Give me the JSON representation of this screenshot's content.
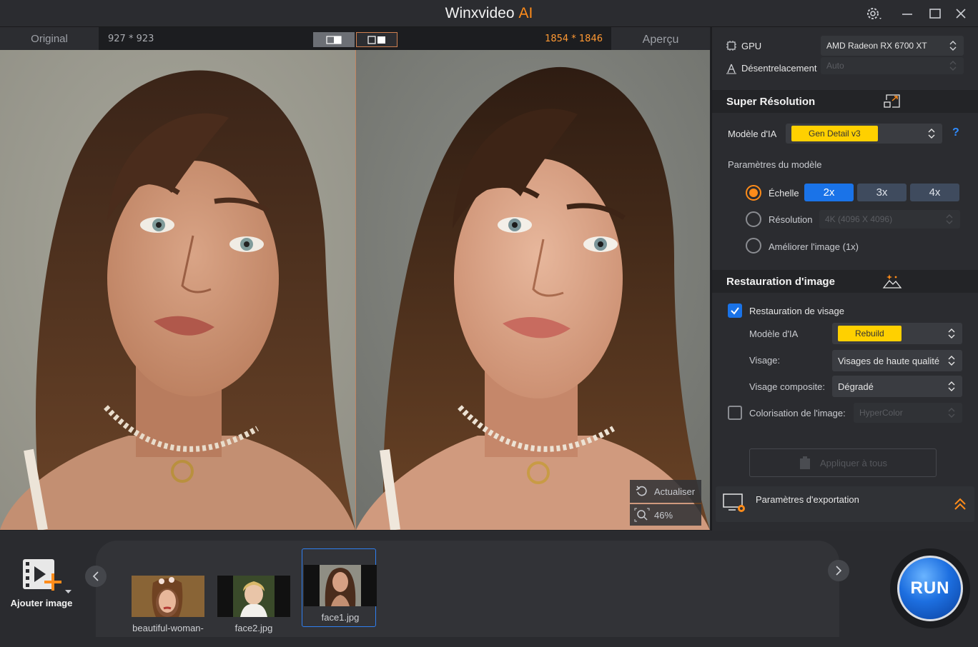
{
  "titlebar": {
    "title": "Winxvideo",
    "title_ai": "AI"
  },
  "compare": {
    "original_label": "Original",
    "original_size": "927 * 923",
    "preview_size": "1854 * 1846",
    "preview_label": "Aperçu",
    "refresh_label": "Actualiser",
    "zoom_label": "46%"
  },
  "panel": {
    "gpu_label": "GPU",
    "gpu_value": "AMD Radeon RX 6700 XT",
    "deinterlace_label": "Désentrelacement",
    "deinterlace_value": "Auto",
    "super_res": {
      "title": "Super Résolution",
      "model_label": "Modèle d'IA",
      "model_value": "Gen Detail v3",
      "help": "?",
      "params_label": "Paramètres du modèle",
      "scale_label": "Échelle",
      "scales": [
        "2x",
        "3x",
        "4x"
      ],
      "resolution_label": "Résolution",
      "resolution_value": "4K (4096 X 4096)",
      "enhance_label": "Améliorer l'image (1x)"
    },
    "restoration": {
      "title": "Restauration d'image",
      "face_restore_label": "Restauration de visage",
      "model_label": "Modèle d'IA",
      "model_value": "Rebuild",
      "face_label": "Visage:",
      "face_value": "Visages de haute qualité",
      "composite_label": "Visage composite:",
      "composite_value": "Dégradé",
      "colorize_label": "Colorisation de l'image:",
      "colorize_value": "HyperColor"
    },
    "apply_all": "Appliquer à tous",
    "export_label": "Paramètres d'exportation"
  },
  "bottom": {
    "add_image_label": "Ajouter image",
    "thumbs": [
      {
        "name": "beautiful-woman-"
      },
      {
        "name": "face2.jpg"
      },
      {
        "name": "face1.jpg"
      }
    ],
    "run_label": "RUN"
  },
  "colors": {
    "accent": "#ff8c1a",
    "blue": "#1a73e8",
    "chip": "#ffd000"
  }
}
